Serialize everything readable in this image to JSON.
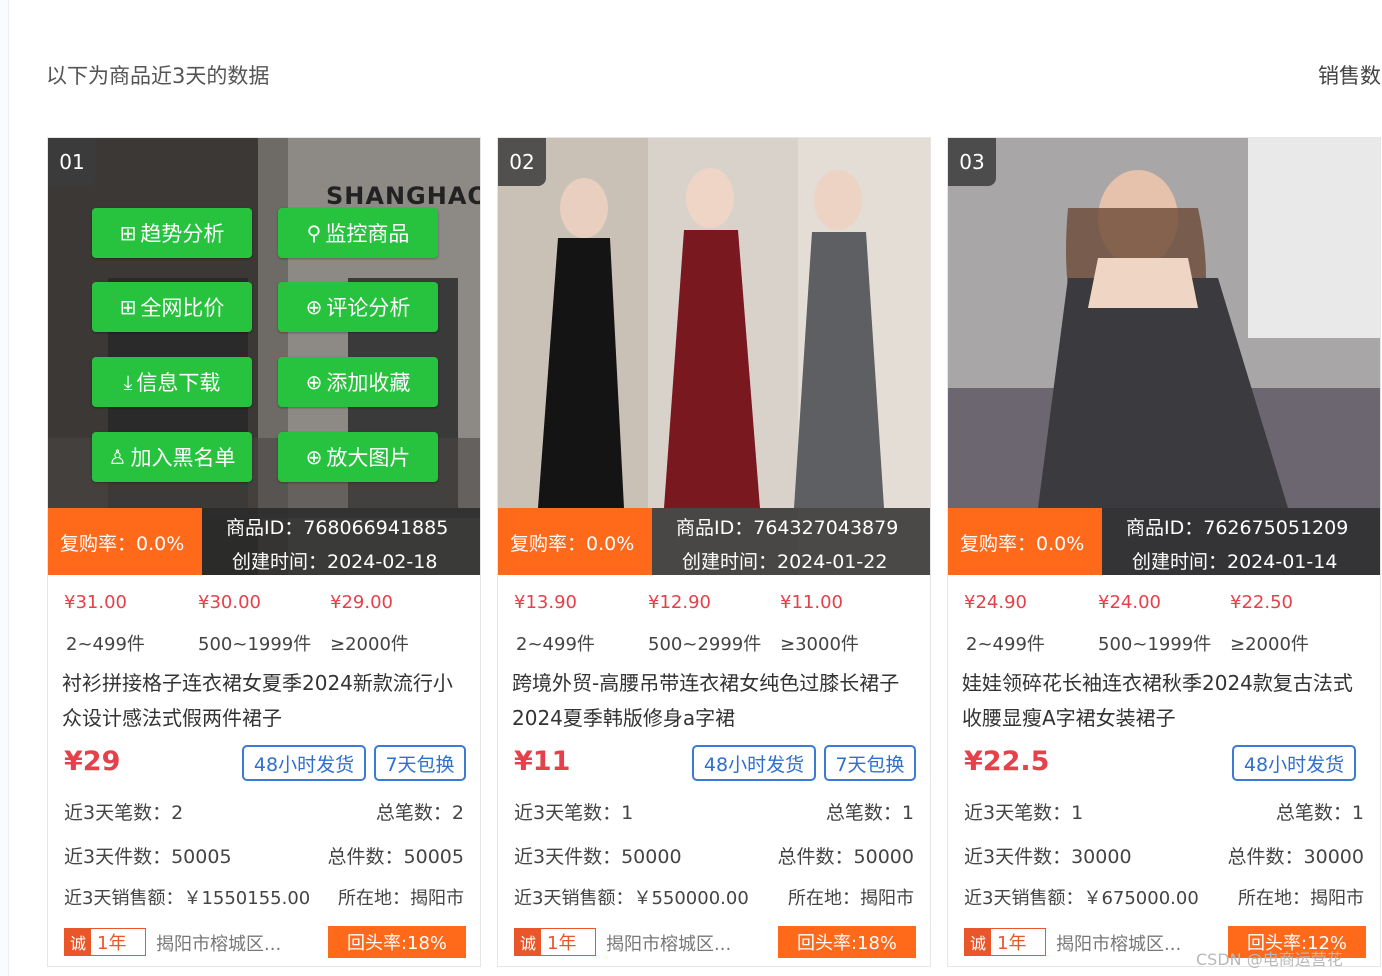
{
  "header": {
    "title": "以下为商品近3天的数据",
    "right_text": "销售数"
  },
  "cards": [
    {
      "rank": "01",
      "repurchase": "复购率：0.0%",
      "product_id": "商品ID：768066941885",
      "created": "创建时间：2024-02-18",
      "prices": [
        "¥31.00",
        "¥30.00",
        "¥29.00"
      ],
      "qtys": [
        "2~499件",
        "500~1999件",
        "≥2000件"
      ],
      "title": "衬衫拼接格子连衣裙女夏季2024新款流行小众设计感法式假两件裙子",
      "price": "¥29",
      "tags": [
        "48小时发货",
        "7天包换"
      ],
      "orders_3d": "近3天笔数：2",
      "orders_total": "总笔数：2",
      "pieces_3d": "近3天件数：50005",
      "pieces_total": "总件数：50005",
      "sales_3d": "近3天销售额：￥1550155.00",
      "location": "所在地：揭阳市",
      "badge_char": "诚",
      "badge_years": "1年",
      "shop": "揭阳市榕城区...",
      "return_rate": "回头率:18%",
      "image_caption": "SHANGHAO",
      "actions": [
        {
          "icon": "trend-icon",
          "label": "趋势分析"
        },
        {
          "icon": "monitor-icon",
          "label": "监控商品"
        },
        {
          "icon": "compare-icon",
          "label": "全网比价"
        },
        {
          "icon": "review-icon",
          "label": "评论分析"
        },
        {
          "icon": "download-icon",
          "label": "信息下载"
        },
        {
          "icon": "favorite-icon",
          "label": "添加收藏"
        },
        {
          "icon": "blacklist-icon",
          "label": "加入黑名单"
        },
        {
          "icon": "zoom-icon",
          "label": "放大图片"
        }
      ]
    },
    {
      "rank": "02",
      "repurchase": "复购率：0.0%",
      "product_id": "商品ID：764327043879",
      "created": "创建时间：2024-01-22",
      "prices": [
        "¥13.90",
        "¥12.90",
        "¥11.00"
      ],
      "qtys": [
        "2~499件",
        "500~2999件",
        "≥3000件"
      ],
      "title": "跨境外贸-高腰吊带连衣裙女纯色过膝长裙子2024夏季韩版修身a字裙",
      "price": "¥11",
      "tags": [
        "48小时发货",
        "7天包换"
      ],
      "orders_3d": "近3天笔数：1",
      "orders_total": "总笔数：1",
      "pieces_3d": "近3天件数：50000",
      "pieces_total": "总件数：50000",
      "sales_3d": "近3天销售额：￥550000.00",
      "location": "所在地：揭阳市",
      "badge_char": "诚",
      "badge_years": "1年",
      "shop": "揭阳市榕城区...",
      "return_rate": "回头率:18%"
    },
    {
      "rank": "03",
      "repurchase": "复购率：0.0%",
      "product_id": "商品ID：762675051209",
      "created": "创建时间：2024-01-14",
      "prices": [
        "¥24.90",
        "¥24.00",
        "¥22.50"
      ],
      "qtys": [
        "2~499件",
        "500~1999件",
        "≥2000件"
      ],
      "title": "娃娃领碎花长袖连衣裙秋季2024款复古法式收腰显瘦A字裙女装裙子",
      "price": "¥22.5",
      "tags": [
        "48小时发货"
      ],
      "orders_3d": "近3天笔数：1",
      "orders_total": "总笔数：1",
      "pieces_3d": "近3天件数：30000",
      "pieces_total": "总件数：30000",
      "sales_3d": "近3天销售额：￥675000.00",
      "location": "所在地：揭阳市",
      "badge_char": "诚",
      "badge_years": "1年",
      "shop": "揭阳市榕城区...",
      "return_rate": "回头率:12%"
    }
  ],
  "watermark": "CSDN @电商运营花",
  "colors": {
    "accent_red": "#e5414a",
    "orange": "#ff6a1a",
    "action_green": "#27c23e",
    "tag_blue": "#2f6fcf"
  }
}
